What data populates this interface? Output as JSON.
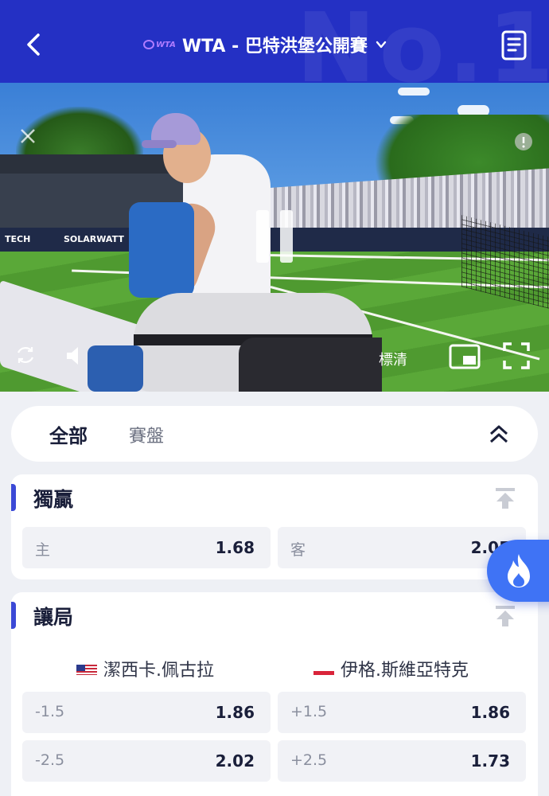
{
  "header": {
    "logo_text": "WTA",
    "title": "WTA - 巴特洪堡公開賽",
    "bg_watermark": "No.1"
  },
  "video": {
    "quality_label": "標清",
    "banners": [
      "TECH",
      "SOLARWATT"
    ]
  },
  "tabs": [
    {
      "label": "全部",
      "active": true
    },
    {
      "label": "賽盤",
      "active": false
    }
  ],
  "markets": {
    "winner": {
      "title": "獨贏",
      "options": [
        {
          "label": "主",
          "odds": "1.68"
        },
        {
          "label": "客",
          "odds": "2.05"
        }
      ]
    },
    "handicap": {
      "title": "讓局",
      "home_team": "潔西卡.佩古拉",
      "away_team": "伊格.斯維亞特克",
      "rows": [
        {
          "home_line": "-1.5",
          "home_odds": "1.86",
          "away_line": "+1.5",
          "away_odds": "1.86"
        },
        {
          "home_line": "-2.5",
          "home_odds": "2.02",
          "away_line": "+2.5",
          "away_odds": "1.73"
        }
      ]
    }
  },
  "colors": {
    "header_bg": "#2430c4",
    "accent": "#3b49d6",
    "fab": "#3f73f5"
  }
}
